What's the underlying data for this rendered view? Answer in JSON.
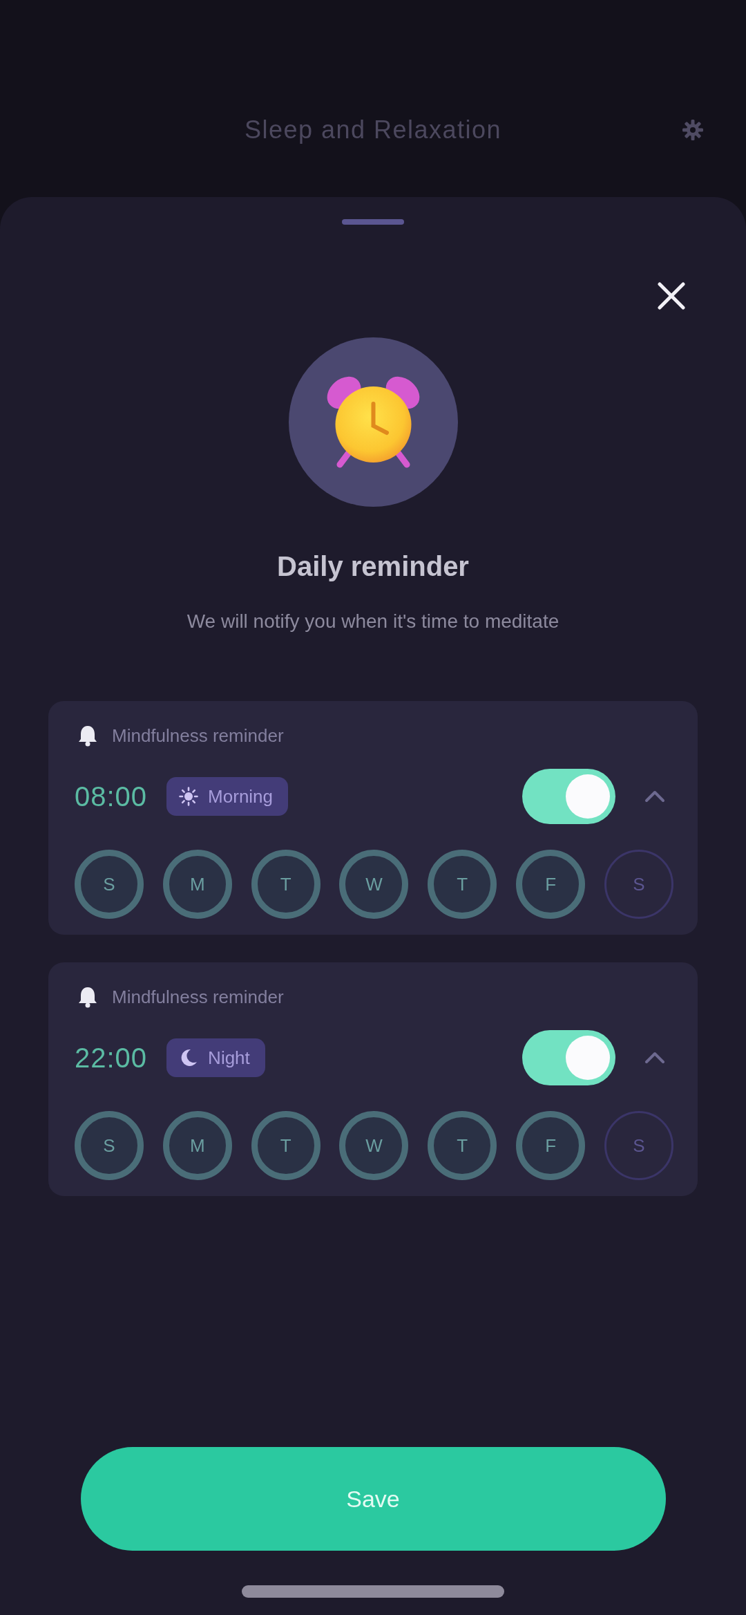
{
  "header": {
    "title": "Sleep and Relaxation"
  },
  "sheet": {
    "title": "Daily reminder",
    "subtitle": "We will notify you when it's time to meditate"
  },
  "reminders": [
    {
      "label": "Mindfulness reminder",
      "time": "08:00",
      "period": {
        "kind": "morning",
        "label": "Morning"
      },
      "on": true,
      "expanded": true,
      "days": [
        {
          "label": "S",
          "selected": true
        },
        {
          "label": "M",
          "selected": true
        },
        {
          "label": "T",
          "selected": true
        },
        {
          "label": "W",
          "selected": true
        },
        {
          "label": "T",
          "selected": true
        },
        {
          "label": "F",
          "selected": true
        },
        {
          "label": "S",
          "selected": false
        }
      ]
    },
    {
      "label": "Mindfulness reminder",
      "time": "22:00",
      "period": {
        "kind": "night",
        "label": "Night"
      },
      "on": true,
      "expanded": true,
      "days": [
        {
          "label": "S",
          "selected": true
        },
        {
          "label": "M",
          "selected": true
        },
        {
          "label": "T",
          "selected": true
        },
        {
          "label": "W",
          "selected": true
        },
        {
          "label": "T",
          "selected": true
        },
        {
          "label": "F",
          "selected": true
        },
        {
          "label": "S",
          "selected": false
        }
      ]
    }
  ],
  "save_button": {
    "label": "Save"
  }
}
